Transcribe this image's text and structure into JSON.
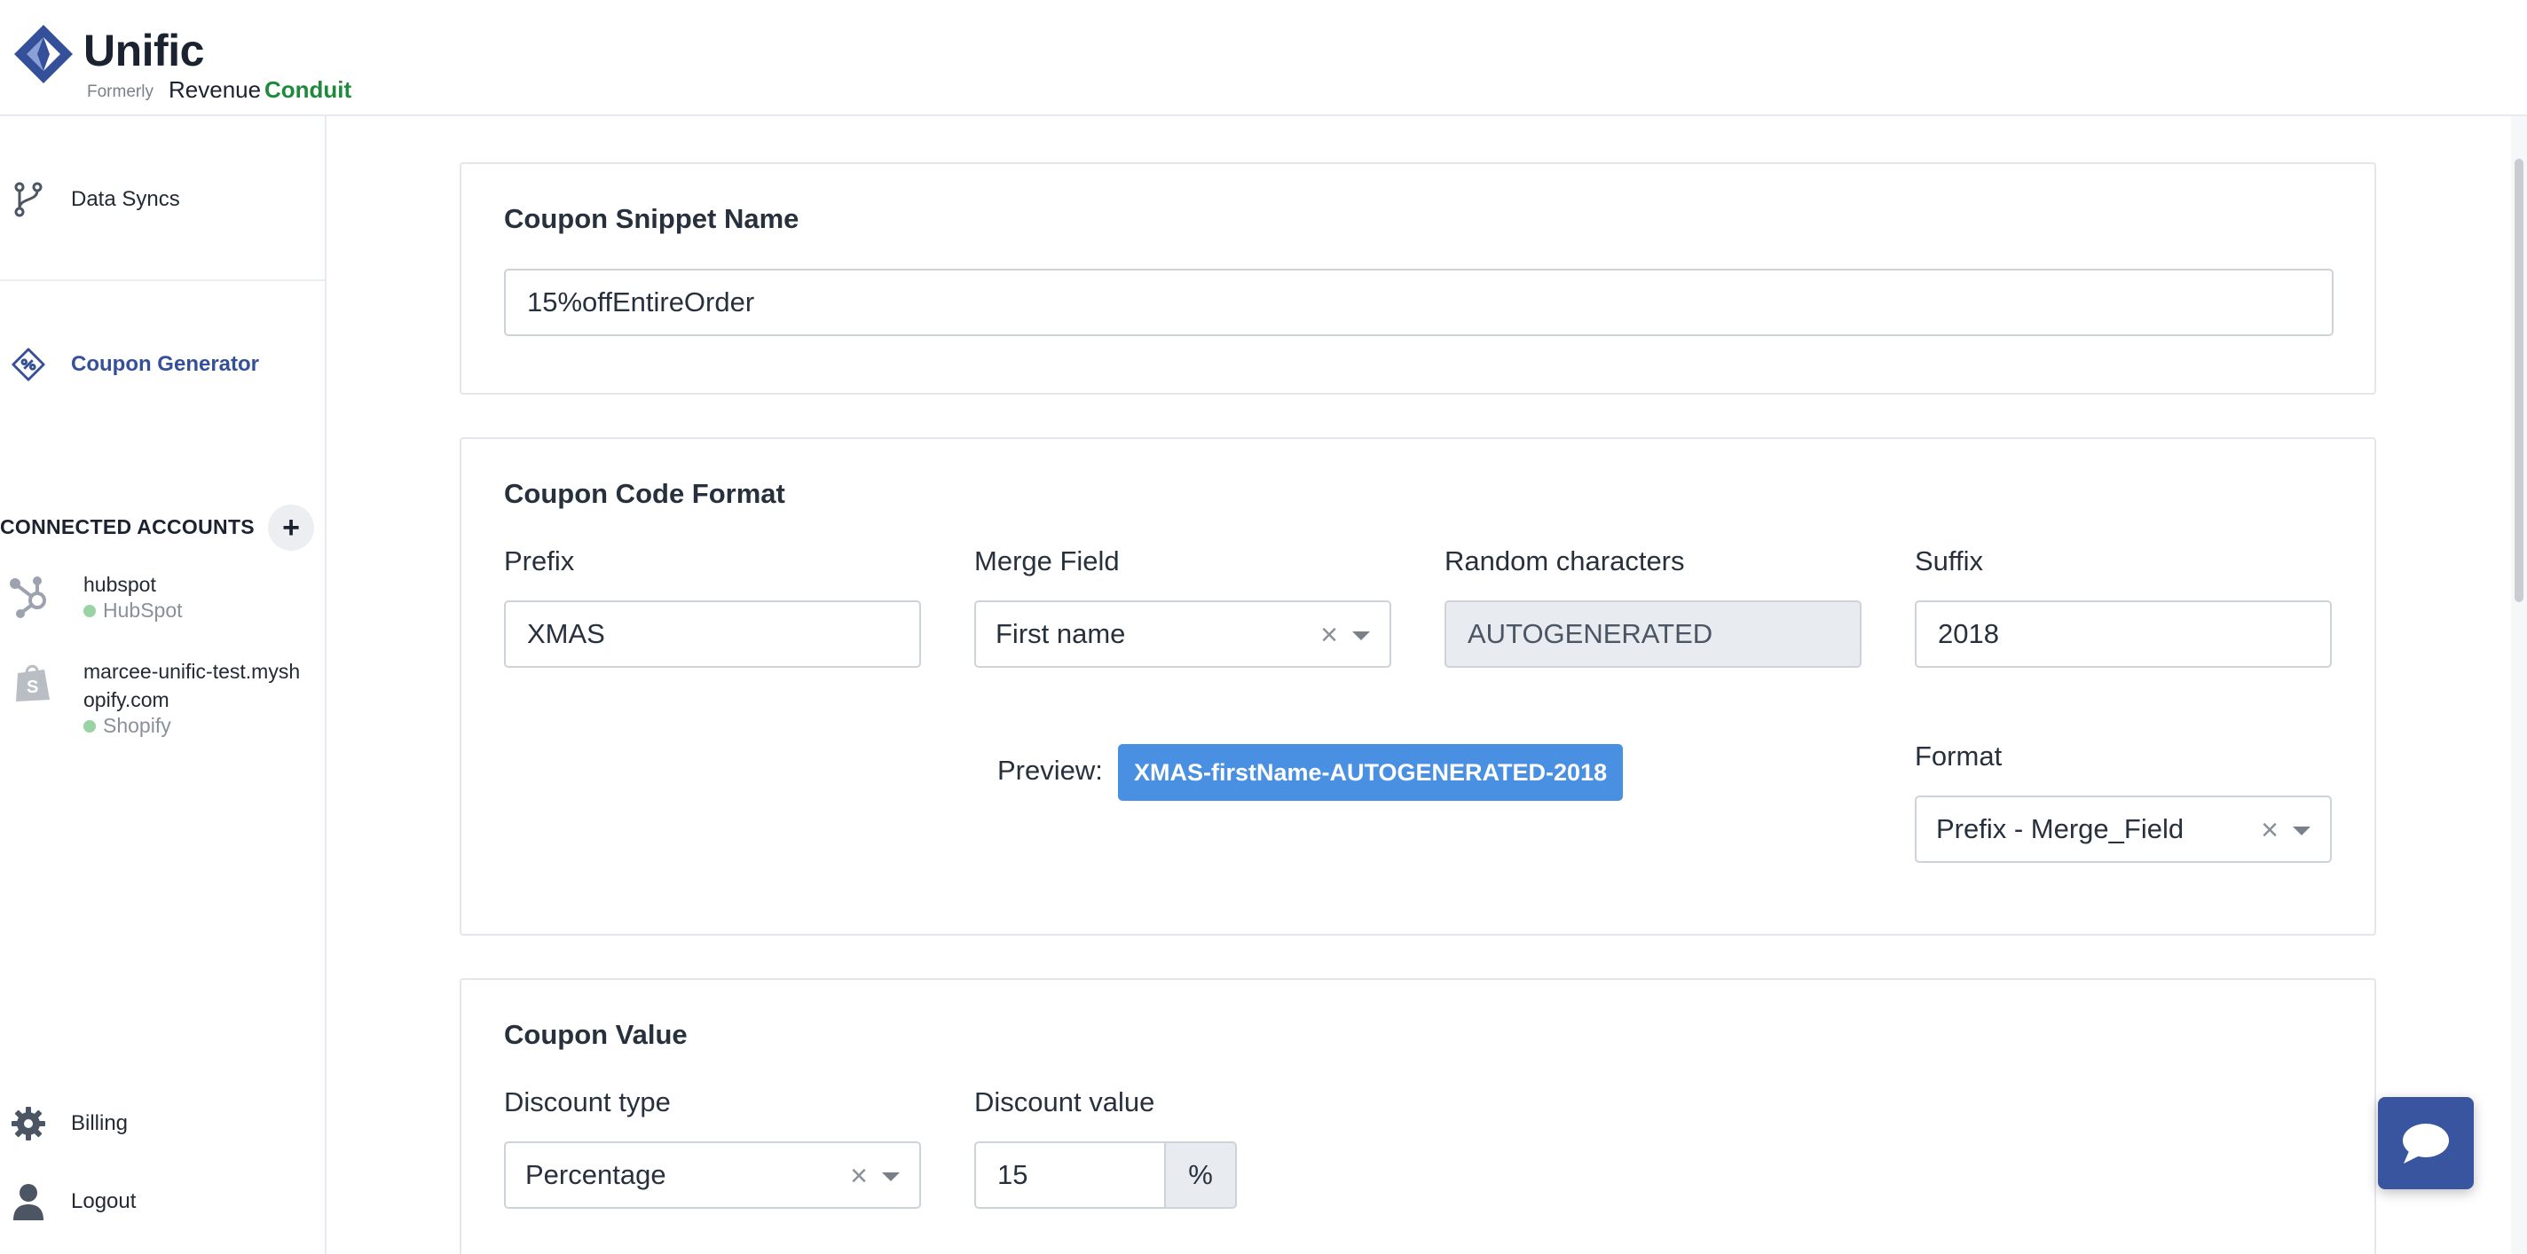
{
  "brand": {
    "name": "Unific",
    "formerly_label": "Formerly",
    "former_name_part1": "Revenue",
    "former_name_part2": "Conduit",
    "primary_color": "#35509a",
    "accent_color": "#1f8a3c"
  },
  "sidebar": {
    "items": [
      {
        "label": "Data Syncs",
        "icon": "branch-icon",
        "active": false
      },
      {
        "label": "Coupon Generator",
        "icon": "coupon-tag-icon",
        "active": true
      }
    ],
    "connected_accounts_title": "CONNECTED ACCOUNTS",
    "add_account_symbol": "+",
    "accounts": [
      {
        "name": "hubspot",
        "platform": "HubSpot",
        "icon": "hubspot-icon",
        "status_color": "#9ad3a3"
      },
      {
        "name": "marcee-unific-test.myshopify.com",
        "platform": "Shopify",
        "icon": "shopify-bag-icon",
        "status_color": "#9ad3a3"
      }
    ],
    "bottom_items": [
      {
        "label": "Billing",
        "icon": "gear-icon"
      },
      {
        "label": "Logout",
        "icon": "user-icon"
      }
    ]
  },
  "main": {
    "snippet_card": {
      "title": "Coupon Snippet Name",
      "value": "15%offEntireOrder"
    },
    "format_card": {
      "title": "Coupon Code Format",
      "prefix_label": "Prefix",
      "prefix_value": "XMAS",
      "merge_label": "Merge Field",
      "merge_value": "First name",
      "random_label": "Random characters",
      "random_value": "AUTOGENERATED",
      "suffix_label": "Suffix",
      "suffix_value": "2018",
      "format_label": "Format",
      "format_value": "Prefix - Merge_Field",
      "preview_label": "Preview:",
      "preview_value": "XMAS-firstName-AUTOGENERATED-2018",
      "clear_symbol": "×"
    },
    "value_card": {
      "title": "Coupon Value",
      "discount_type_label": "Discount type",
      "discount_type_value": "Percentage",
      "discount_value_label": "Discount value",
      "discount_value": "15",
      "discount_unit": "%"
    }
  }
}
